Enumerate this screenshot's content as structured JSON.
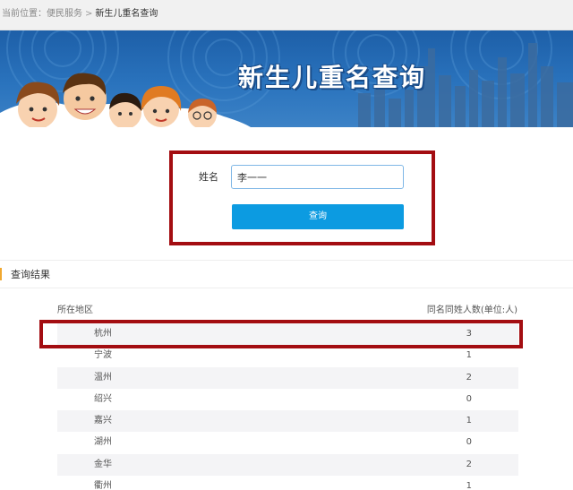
{
  "breadcrumb": {
    "prefix": "当前位置：",
    "parent": "便民服务",
    "separator": ">",
    "current": "新生儿重名查询"
  },
  "banner": {
    "title": "新生儿重名查询"
  },
  "form": {
    "name_label": "姓名",
    "name_value": "李一一",
    "submit_label": "查询"
  },
  "results": {
    "section_title": "查询结果",
    "column_region": "所在地区",
    "column_count": "同名同姓人数(单位:人)",
    "rows": [
      {
        "region": "杭州",
        "count": "3"
      },
      {
        "region": "宁波",
        "count": "1"
      },
      {
        "region": "温州",
        "count": "2"
      },
      {
        "region": "绍兴",
        "count": "0"
      },
      {
        "region": "嘉兴",
        "count": "1"
      },
      {
        "region": "湖州",
        "count": "0"
      },
      {
        "region": "金华",
        "count": "2"
      },
      {
        "region": "衢州",
        "count": "1"
      }
    ]
  },
  "colors": {
    "highlight_frame": "#a30d11",
    "button": "#0c9be1",
    "banner": "#2a73bd",
    "section_marker": "#f0a830"
  }
}
